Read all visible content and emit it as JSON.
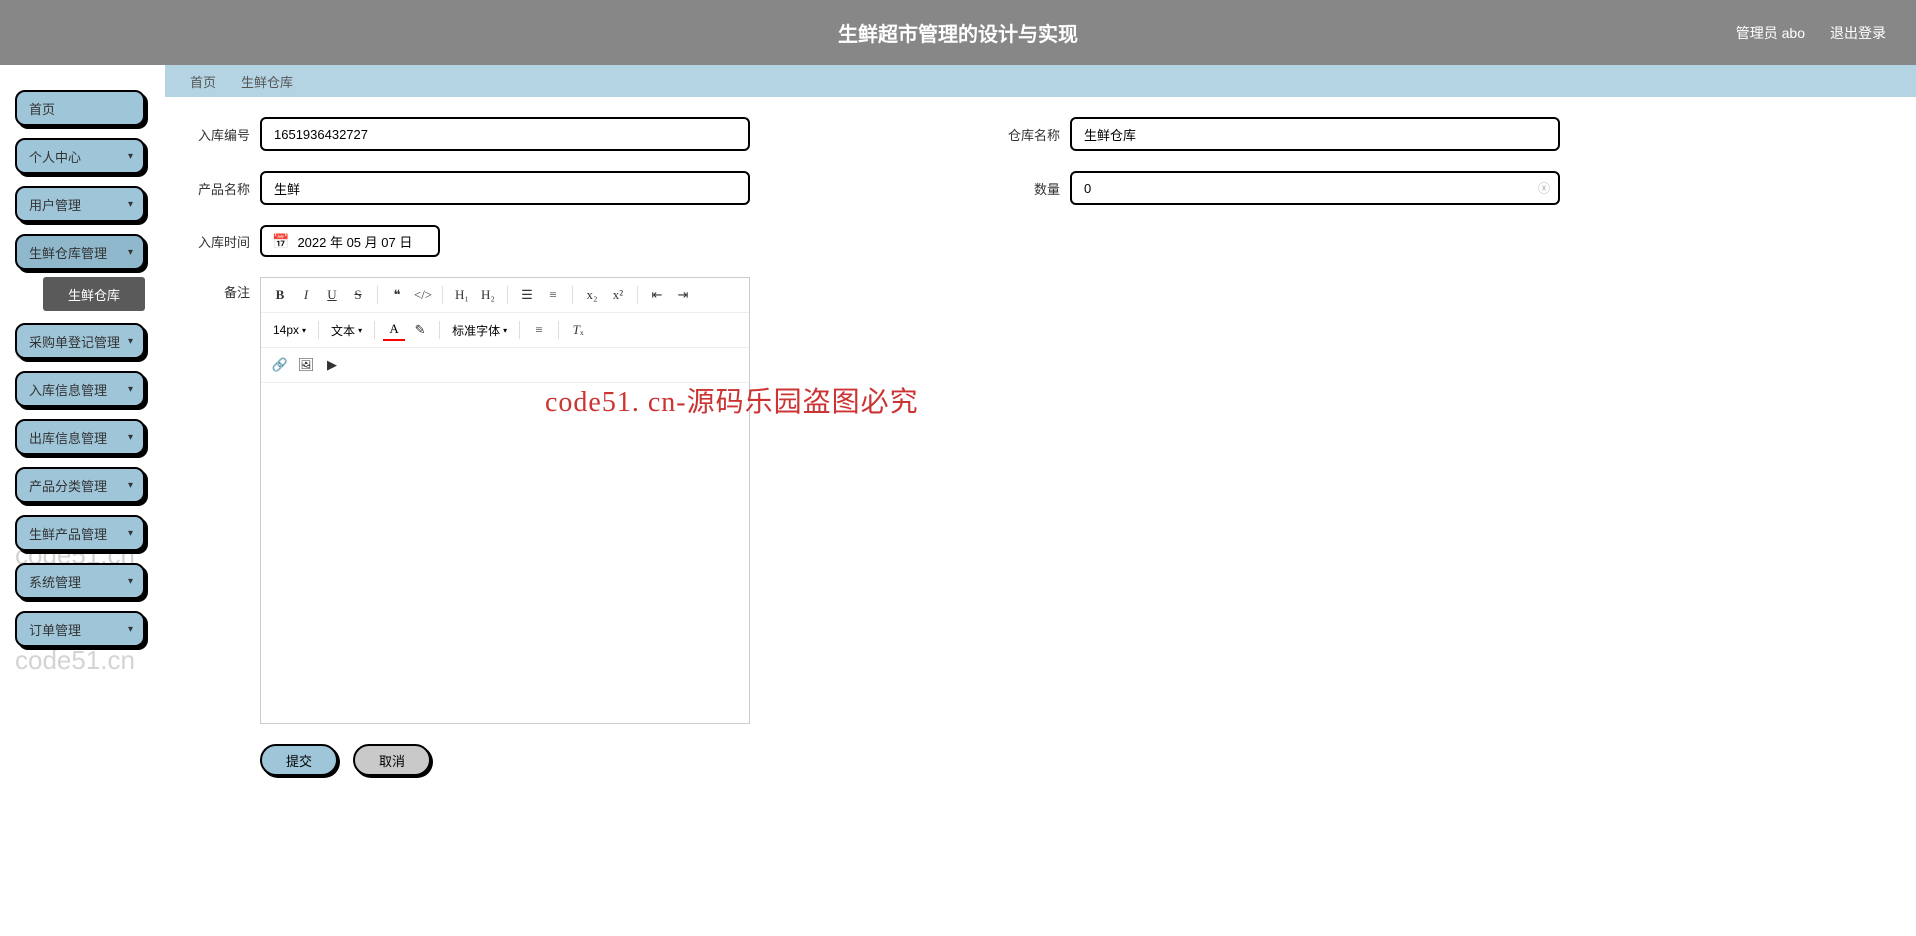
{
  "header": {
    "title": "生鲜超市管理的设计与实现",
    "user": "管理员 abo",
    "logout": "退出登录"
  },
  "sidebar": {
    "items": [
      {
        "label": "首页",
        "expandable": false
      },
      {
        "label": "个人中心",
        "expandable": true
      },
      {
        "label": "用户管理",
        "expandable": true
      },
      {
        "label": "生鲜仓库管理",
        "expandable": true,
        "active": true
      },
      {
        "label": "采购单登记管理",
        "expandable": true
      },
      {
        "label": "入库信息管理",
        "expandable": true
      },
      {
        "label": "出库信息管理",
        "expandable": true
      },
      {
        "label": "产品分类管理",
        "expandable": true
      },
      {
        "label": "生鲜产品管理",
        "expandable": true
      },
      {
        "label": "系统管理",
        "expandable": true
      },
      {
        "label": "订单管理",
        "expandable": true
      }
    ],
    "submenu": "生鲜仓库"
  },
  "breadcrumb": {
    "home": "首页",
    "current": "生鲜仓库"
  },
  "form": {
    "fields": {
      "stockNo": {
        "label": "入库编号",
        "value": "1651936432727"
      },
      "warehouseName": {
        "label": "仓库名称",
        "value": "生鲜仓库"
      },
      "productName": {
        "label": "产品名称",
        "value": "生鲜"
      },
      "quantity": {
        "label": "数量",
        "value": "0"
      },
      "stockTime": {
        "label": "入库时间",
        "value": "2022 年 05 月 07 日"
      },
      "remark": {
        "label": "备注"
      }
    },
    "editor": {
      "fontSize": "14px",
      "textLabel": "文本",
      "fontLabel": "标准字体"
    },
    "buttons": {
      "submit": "提交",
      "cancel": "取消"
    }
  },
  "watermark": {
    "text": "code51.cn",
    "center": "code51. cn-源码乐园盗图必究"
  }
}
